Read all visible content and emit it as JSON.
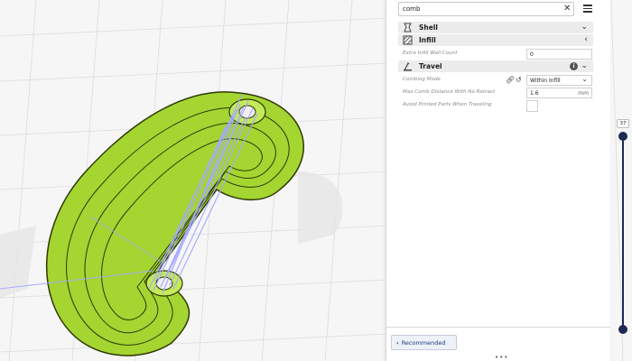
{
  "search": {
    "value": "comb"
  },
  "categories": [
    {
      "label": "Shell",
      "icon": "shell-icon"
    },
    {
      "label": "Infill",
      "icon": "infill-icon"
    },
    {
      "label": "Travel",
      "icon": "travel-icon"
    }
  ],
  "settings": {
    "extra_infill_wall_count": {
      "label": "Extra Infill Wall Count",
      "value": "0"
    },
    "combing_mode": {
      "label": "Combing Mode",
      "value": "Within Infill"
    },
    "max_comb_distance": {
      "label": "Max Comb Distance With No Retract",
      "value": "1.6",
      "unit": "mm"
    },
    "avoid_printed_parts": {
      "label": "Avoid Printed Parts When Traveling",
      "checked": false
    }
  },
  "footer": {
    "recommended_label": "Recommended"
  },
  "layer_slider": {
    "current_layer": "37"
  },
  "colors": {
    "model": "#a4d531",
    "travel": "#a6a8ff",
    "accent": "#1e2a55",
    "panel": "#ffffff"
  }
}
